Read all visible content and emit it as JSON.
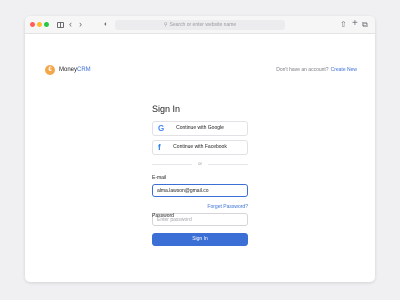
{
  "browser": {
    "url_placeholder": "Search or enter website name",
    "icons": [
      "sidebar-icon",
      "back-icon",
      "forward-icon",
      "shield-icon",
      "search-icon",
      "share-icon",
      "new-tab-icon",
      "tabs-icon"
    ]
  },
  "brand": {
    "logo_letter": "€",
    "name_part1": "Money",
    "name_part2": "CRM",
    "accent_color": "#3b6fd6",
    "logo_color": "#f3a64a"
  },
  "header": {
    "cta_text": "Don't have an account?",
    "cta_link": "Create New"
  },
  "signin": {
    "title": "Sign In",
    "google_label": "Continue with Google",
    "facebook_label": "Continue with Facebook",
    "divider": "or",
    "email_label": "E-mail",
    "email_value": "alma.lawson@gmail.co",
    "password_label": "Password",
    "forgot_link": "Forget Password?",
    "password_placeholder": "Enter password",
    "submit_label": "Sign In"
  }
}
